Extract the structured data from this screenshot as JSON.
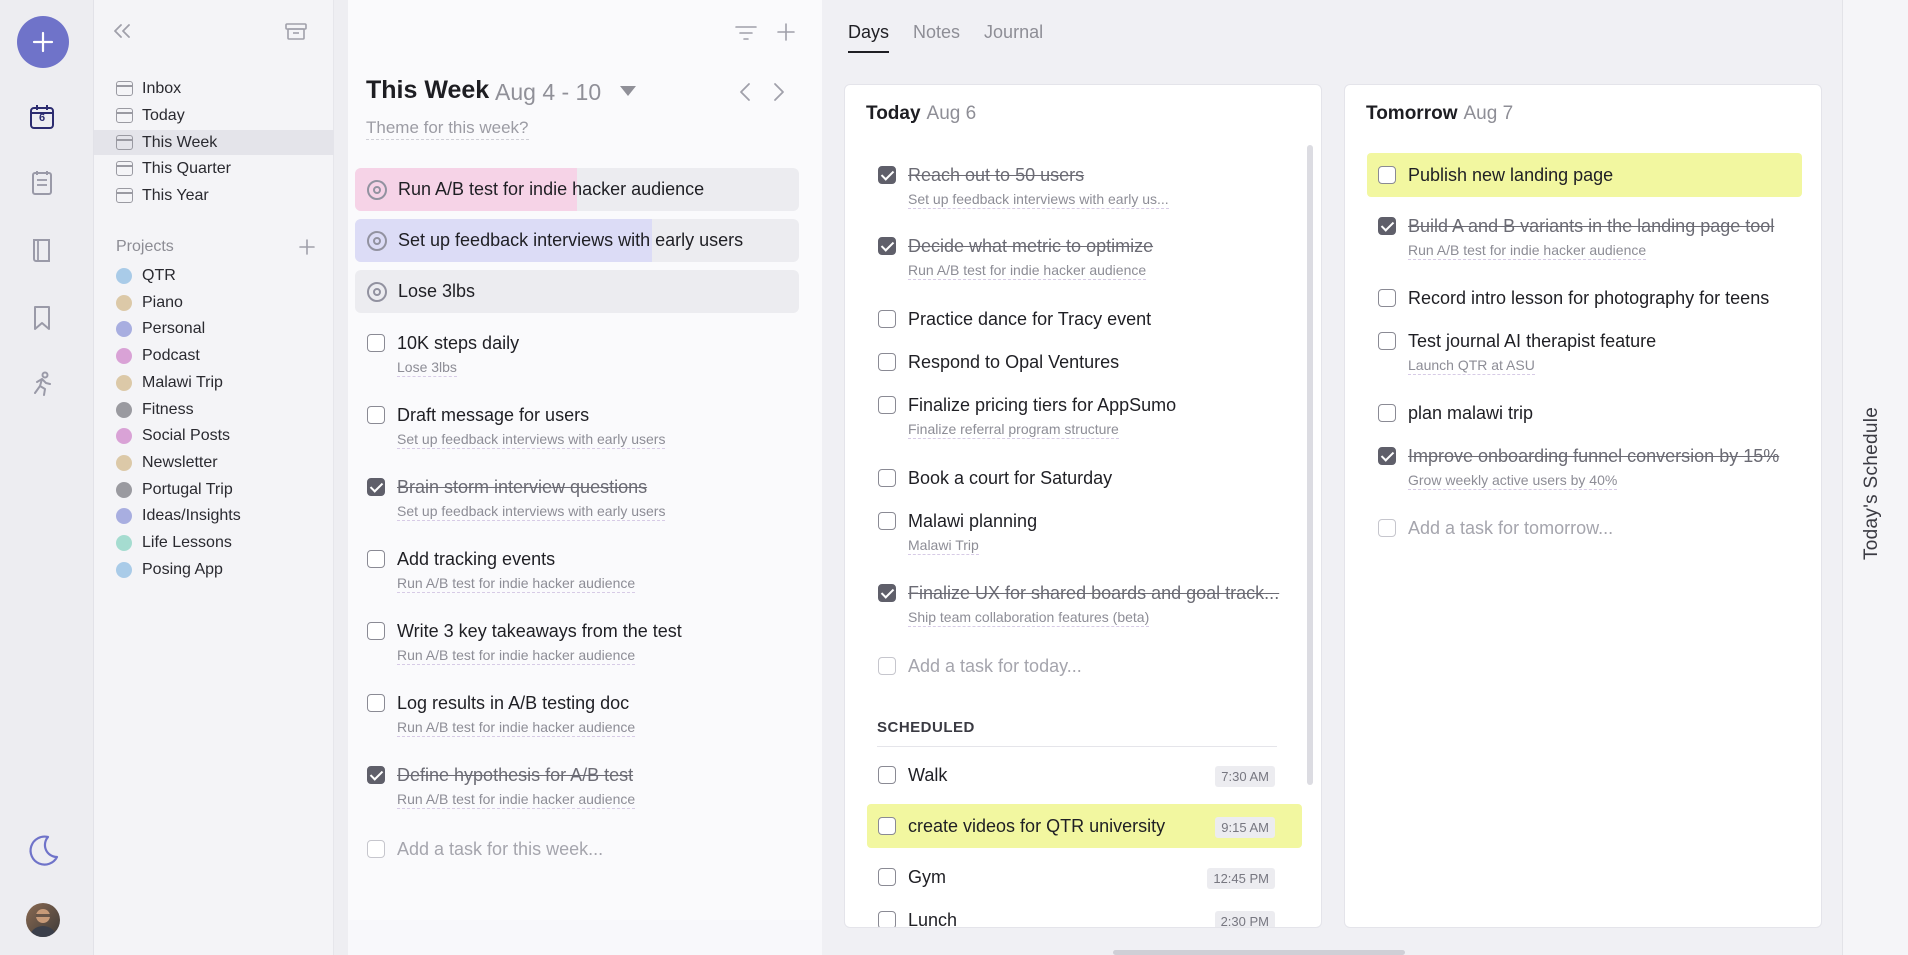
{
  "rail": {
    "date_badge": "6"
  },
  "sidebar": {
    "nav": [
      {
        "label": "Inbox"
      },
      {
        "label": "Today"
      },
      {
        "label": "This Week"
      },
      {
        "label": "This Quarter"
      },
      {
        "label": "This Year"
      }
    ],
    "projects_label": "Projects",
    "projects": [
      {
        "label": "QTR",
        "color": "#a9cbe8"
      },
      {
        "label": "Piano",
        "color": "#dcc9a8"
      },
      {
        "label": "Personal",
        "color": "#a8aee0"
      },
      {
        "label": "Podcast",
        "color": "#d9a2d6"
      },
      {
        "label": "Malawi Trip",
        "color": "#dcc9a8"
      },
      {
        "label": "Fitness",
        "color": "#9a9aa0"
      },
      {
        "label": "Social Posts",
        "color": "#d9a2d6"
      },
      {
        "label": "Newsletter",
        "color": "#dcc9a8"
      },
      {
        "label": "Portugal Trip",
        "color": "#9a9aa0"
      },
      {
        "label": "Ideas/Insights",
        "color": "#a8aee0"
      },
      {
        "label": "Life Lessons",
        "color": "#a5dcd0"
      },
      {
        "label": "Posing App",
        "color": "#a9cbe8"
      }
    ]
  },
  "week": {
    "title": "This Week",
    "range": "Aug 4 - 10",
    "theme_placeholder": "Theme for this week?",
    "goals": [
      {
        "label": "Run A/B test for indie hacker audience",
        "progress": 0.5,
        "color": "#f6d3e7"
      },
      {
        "label": "Set up feedback interviews with early users",
        "progress": 0.67,
        "color": "#dcdcf6"
      },
      {
        "label": "Lose 3lbs",
        "progress": 0,
        "color": "#ececf0"
      }
    ],
    "tasks": [
      {
        "title": "10K steps daily",
        "sub": "Lose 3lbs",
        "done": false
      },
      {
        "title": "Draft message for users",
        "sub": "Set up feedback interviews with early users",
        "done": false
      },
      {
        "title": "Brain storm interview questions",
        "sub": "Set up feedback interviews with early users",
        "done": true
      },
      {
        "title": "Add tracking events",
        "sub": "Run A/B test for indie hacker audience",
        "done": false
      },
      {
        "title": "Write 3 key takeaways from the test",
        "sub": "Run A/B test for indie hacker audience",
        "done": false
      },
      {
        "title": "Log results in A/B testing doc",
        "sub": "Run A/B test for indie hacker audience",
        "done": false
      },
      {
        "title": "Define hypothesis for A/B test",
        "sub": "Run A/B test for indie hacker audience",
        "done": true
      }
    ],
    "add_placeholder": "Add a task for this week..."
  },
  "right": {
    "tabs": [
      "Days",
      "Notes",
      "Journal"
    ],
    "today": {
      "label": "Today",
      "date": "Aug 6",
      "tasks": [
        {
          "title": "Reach out to 50 users",
          "sub": "Set up feedback interviews with early us...",
          "done": true
        },
        {
          "title": "Decide what metric to optimize",
          "sub": "Run A/B test for indie hacker audience",
          "done": true
        },
        {
          "title": "Practice dance for Tracy event",
          "done": false
        },
        {
          "title": "Respond to Opal Ventures",
          "done": false
        },
        {
          "title": "Finalize pricing tiers for AppSumo",
          "sub": "Finalize referral program structure",
          "done": false
        },
        {
          "title": "Book a court for Saturday",
          "done": false
        },
        {
          "title": "Malawi planning",
          "sub": "Malawi Trip",
          "done": false
        },
        {
          "title": "Finalize UX for shared boards and goal track...",
          "sub": "Ship team collaboration features (beta)",
          "done": true
        }
      ],
      "add_placeholder": "Add a task for today...",
      "scheduled_label": "SCHEDULED",
      "scheduled": [
        {
          "title": "Walk",
          "time": "7:30 AM"
        },
        {
          "title": "create videos for QTR university",
          "time": "9:15 AM",
          "highlight": true
        },
        {
          "title": "Gym",
          "time": "12:45 PM"
        },
        {
          "title": "Lunch",
          "time": "2:30 PM"
        }
      ]
    },
    "tomorrow": {
      "label": "Tomorrow",
      "date": "Aug 7",
      "tasks": [
        {
          "title": "Publish new landing page",
          "done": false,
          "highlight": true
        },
        {
          "title": "Build A and B variants in the landing page tool",
          "sub": "Run A/B test for indie hacker audience",
          "done": true
        },
        {
          "title": "Record intro lesson for photography for teens",
          "done": false
        },
        {
          "title": "Test journal AI therapist feature",
          "sub": "Launch QTR at ASU",
          "done": false
        },
        {
          "title": "plan malawi trip",
          "done": false
        },
        {
          "title": "Improve onboarding funnel conversion by 15%",
          "sub": "Grow weekly active users by 40%",
          "done": true
        }
      ],
      "add_placeholder": "Add a task for tomorrow..."
    },
    "schedule_side_label": "Today's Schedule"
  }
}
